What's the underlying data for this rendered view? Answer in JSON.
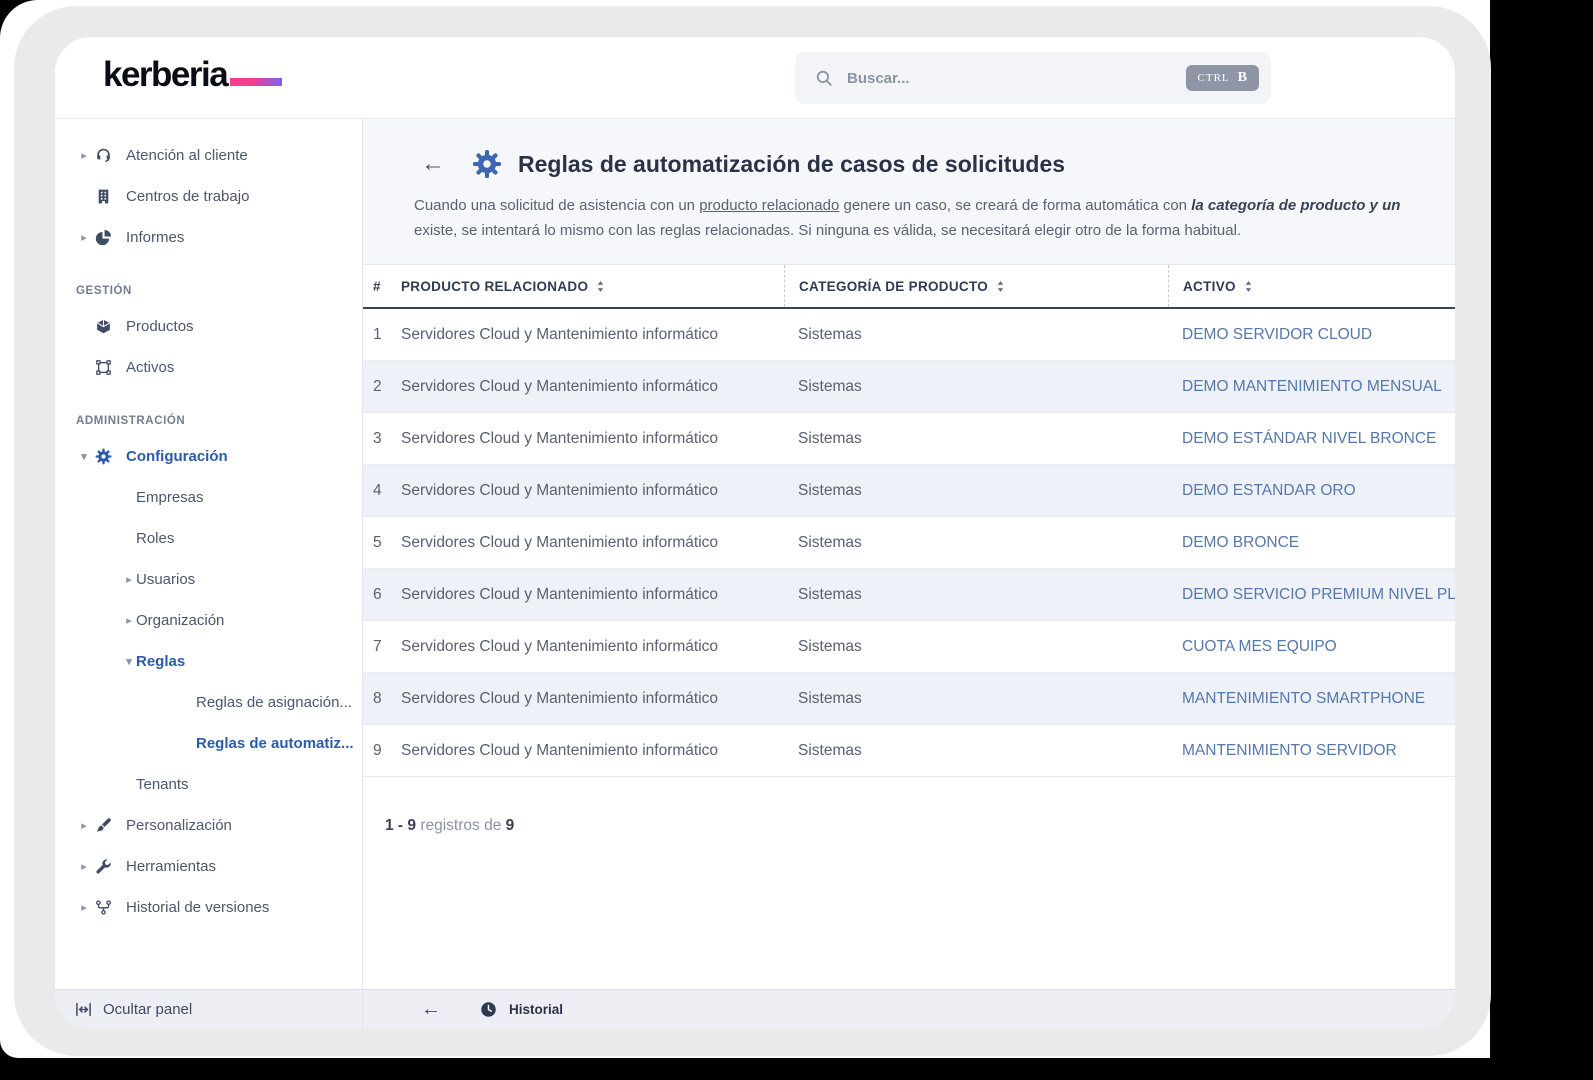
{
  "brand": {
    "name": "kerberia"
  },
  "search": {
    "placeholder": "Buscar...",
    "shortcut_mod": "CTRL",
    "shortcut_key": "B"
  },
  "sidebar": {
    "items": [
      {
        "type": "item",
        "label": "Atención al cliente",
        "icon": "headset-icon",
        "caret": "right",
        "depth": 0,
        "active": false
      },
      {
        "type": "item",
        "label": "Centros de trabajo",
        "icon": "building-icon",
        "caret": "none",
        "depth": 0,
        "active": false
      },
      {
        "type": "item",
        "label": "Informes",
        "icon": "pie-chart-icon",
        "caret": "right",
        "depth": 0,
        "active": false
      },
      {
        "type": "section",
        "label": "GESTIÓN"
      },
      {
        "type": "item",
        "label": "Productos",
        "icon": "cube-icon",
        "caret": "none",
        "depth": 0,
        "active": false
      },
      {
        "type": "item",
        "label": "Activos",
        "icon": "asset-frame-icon",
        "caret": "none",
        "depth": 0,
        "active": false
      },
      {
        "type": "section",
        "label": "ADMINISTRACIÓN"
      },
      {
        "type": "item",
        "label": "Configuración",
        "icon": "gear-icon",
        "caret": "down",
        "depth": 0,
        "active": true
      },
      {
        "type": "item",
        "label": "Empresas",
        "icon": "",
        "caret": "none",
        "depth": 1,
        "active": false
      },
      {
        "type": "item",
        "label": "Roles",
        "icon": "",
        "caret": "none",
        "depth": 1,
        "active": false
      },
      {
        "type": "item",
        "label": "Usuarios",
        "icon": "",
        "caret": "right",
        "depth": 1,
        "active": false
      },
      {
        "type": "item",
        "label": "Organización",
        "icon": "",
        "caret": "right",
        "depth": 1,
        "active": false
      },
      {
        "type": "item",
        "label": "Reglas",
        "icon": "",
        "caret": "down",
        "depth": 1,
        "active": true
      },
      {
        "type": "item",
        "label": "Reglas de asignación...",
        "icon": "",
        "caret": "none",
        "depth": 2,
        "active": false
      },
      {
        "type": "item",
        "label": "Reglas de automatiz...",
        "icon": "",
        "caret": "none",
        "depth": 2,
        "active": true
      },
      {
        "type": "item",
        "label": "Tenants",
        "icon": "",
        "caret": "none",
        "depth": 1,
        "active": false
      },
      {
        "type": "item",
        "label": "Personalización",
        "icon": "paintbrush-icon",
        "caret": "right",
        "depth": 0,
        "active": false
      },
      {
        "type": "item",
        "label": "Herramientas",
        "icon": "wrench-icon",
        "caret": "right",
        "depth": 0,
        "active": false
      },
      {
        "type": "item",
        "label": "Historial de versiones",
        "icon": "versions-icon",
        "caret": "right",
        "depth": 0,
        "active": false
      }
    ],
    "footer": {
      "label": "Ocultar panel"
    }
  },
  "page": {
    "title": "Reglas de automatización de casos de solicitudes",
    "desc_line1_part1": "Cuando una solicitud de asistencia con un ",
    "desc_line1_link": "producto relacionado",
    "desc_line1_part2": " genere un caso, se creará de forma automática con ",
    "desc_line1_emphasis": "la categoría de producto y un",
    "desc_line2": "existe, se intentará lo mismo con las reglas relacionadas. Si ninguna es válida, se necesitará elegir otro de la forma habitual."
  },
  "table": {
    "columns": [
      {
        "label": "#",
        "sortable": false
      },
      {
        "label": "PRODUCTO RELACIONADO",
        "sortable": true
      },
      {
        "label": "CATEGORÍA DE PRODUCTO",
        "sortable": true
      },
      {
        "label": "ACTIVO",
        "sortable": true
      }
    ],
    "rows": [
      {
        "num": "1",
        "producto": "Servidores Cloud y Mantenimiento informático",
        "categoria": "Sistemas",
        "activo": "DEMO SERVIDOR CLOUD"
      },
      {
        "num": "2",
        "producto": "Servidores Cloud y Mantenimiento informático",
        "categoria": "Sistemas",
        "activo": "DEMO MANTENIMIENTO MENSUAL"
      },
      {
        "num": "3",
        "producto": "Servidores Cloud y Mantenimiento informático",
        "categoria": "Sistemas",
        "activo": "DEMO ESTÁNDAR NIVEL BRONCE"
      },
      {
        "num": "4",
        "producto": "Servidores Cloud y Mantenimiento informático",
        "categoria": "Sistemas",
        "activo": "DEMO ESTANDAR ORO"
      },
      {
        "num": "5",
        "producto": "Servidores Cloud y Mantenimiento informático",
        "categoria": "Sistemas",
        "activo": "DEMO BRONCE"
      },
      {
        "num": "6",
        "producto": "Servidores Cloud y Mantenimiento informático",
        "categoria": "Sistemas",
        "activo": "DEMO SERVICIO PREMIUM NIVEL PL"
      },
      {
        "num": "7",
        "producto": "Servidores Cloud y Mantenimiento informático",
        "categoria": "Sistemas",
        "activo": "CUOTA MES EQUIPO"
      },
      {
        "num": "8",
        "producto": "Servidores Cloud y Mantenimiento informático",
        "categoria": "Sistemas",
        "activo": "MANTENIMIENTO SMARTPHONE"
      },
      {
        "num": "9",
        "producto": "Servidores Cloud y Mantenimiento informático",
        "categoria": "Sistemas",
        "activo": "MANTENIMIENTO SERVIDOR"
      }
    ],
    "summary": {
      "range": "1 - 9",
      "middle": "registros de",
      "total": "9"
    }
  },
  "footer_bar": {
    "history_label": "Historial"
  },
  "colors": {
    "accent_blue": "#2c5ca9",
    "link_blue": "#5578ab",
    "brand_gradient_start": "#f43f8e",
    "brand_gradient_end": "#7b61f0"
  }
}
